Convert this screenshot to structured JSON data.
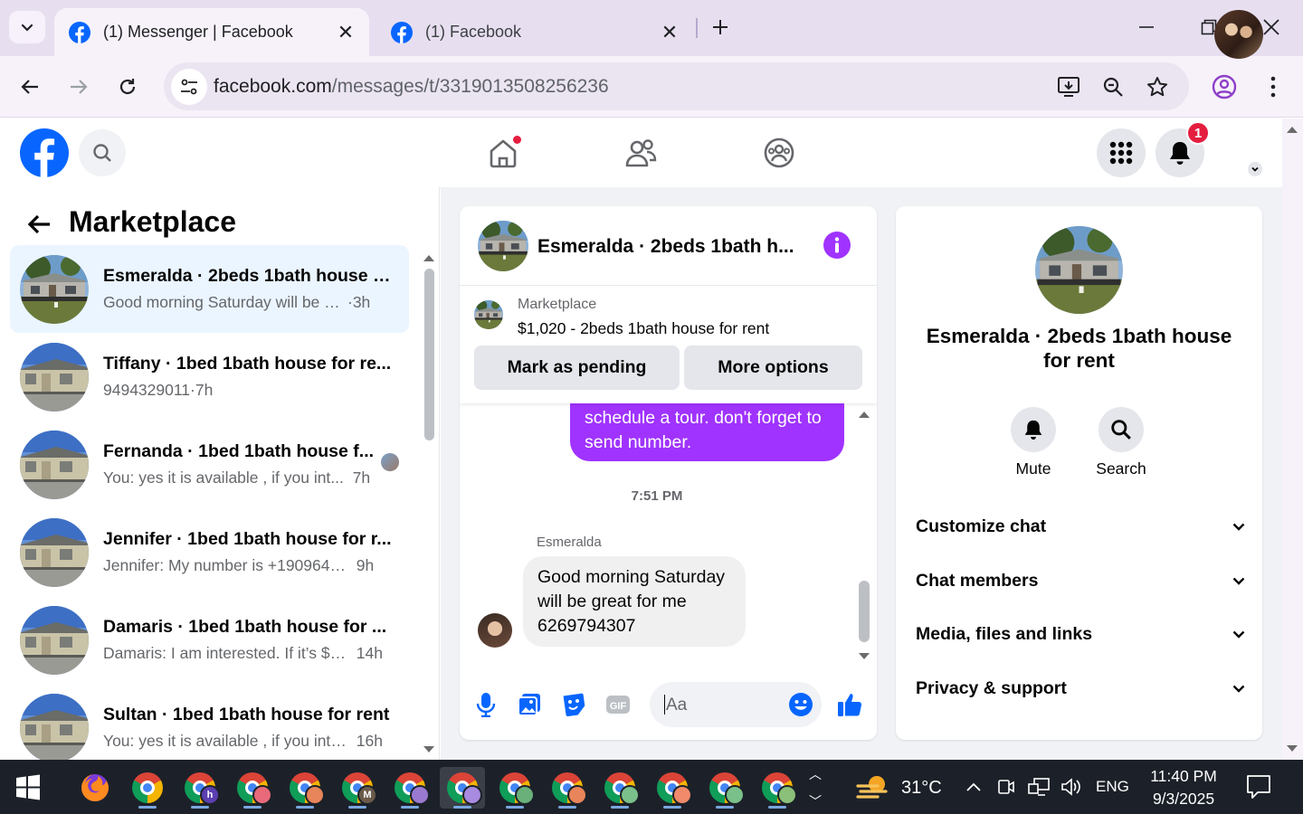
{
  "browser": {
    "tabs": [
      {
        "title": "(1) Messenger | Facebook",
        "active": true
      },
      {
        "title": "(1) Facebook",
        "active": false
      }
    ],
    "url_domain": "facebook.com",
    "url_path": "/messages/t/3319013508256236"
  },
  "fb_header": {
    "notification_count": "1",
    "nav": [
      "home-icon",
      "friends-icon",
      "groups-icon"
    ]
  },
  "marketplace": {
    "title": "Marketplace",
    "conversations": [
      {
        "name": "Esmeralda · 2beds 1bath house f...",
        "preview": "Good morning Saturday will be gre...",
        "time": "3h",
        "active": true
      },
      {
        "name": "Tiffany · 1bed 1bath house for re...",
        "preview": "9494329011",
        "time": "7h",
        "active": false
      },
      {
        "name": "Fernanda · 1bed 1bath house f...",
        "preview": "You: yes it is available , if you int...",
        "time": "7h",
        "active": false,
        "seen_avatar": true
      },
      {
        "name": "Jennifer · 1bed 1bath house for r...",
        "preview": "Jennifer: My number is +19096443...",
        "time": "9h",
        "active": false
      },
      {
        "name": "Damaris · 1bed 1bath house for ...",
        "preview": "Damaris: I am interested. If it’s $7...",
        "time": "14h",
        "active": false
      },
      {
        "name": "Sultan · 1bed 1bath house for rent",
        "preview": "You: yes it is available , if you inter...",
        "time": "16h",
        "active": false
      }
    ]
  },
  "chat": {
    "title": "Esmeralda · 2beds 1bath h...",
    "listing": {
      "category": "Marketplace",
      "title": "$1,020 - 2beds 1bath house for rent",
      "mark_pending_label": "Mark as pending",
      "more_options_label": "More options"
    },
    "outgoing_message": "schedule  a tour. don't forget to send  number.",
    "timestamp": "7:51 PM",
    "sender_name": "Esmeralda",
    "incoming_message": "Good morning Saturday will be great for me 6269794307",
    "composer_placeholder": "Aa"
  },
  "info_panel": {
    "name": "Esmeralda · 2beds 1bath house for rent",
    "mute_label": "Mute",
    "search_label": "Search",
    "sections": [
      "Customize chat",
      "Chat members",
      "Media, files and links",
      "Privacy & support"
    ]
  },
  "taskbar": {
    "temperature": "31°C",
    "language": "ENG",
    "time": "11:40 PM",
    "date": "9/3/2025"
  },
  "colors": {
    "fb_blue": "#0866ff",
    "messenger_purple": "#a033ff",
    "active_row": "#ebf5ff",
    "chrome_tabbar": "#e7dff0"
  }
}
